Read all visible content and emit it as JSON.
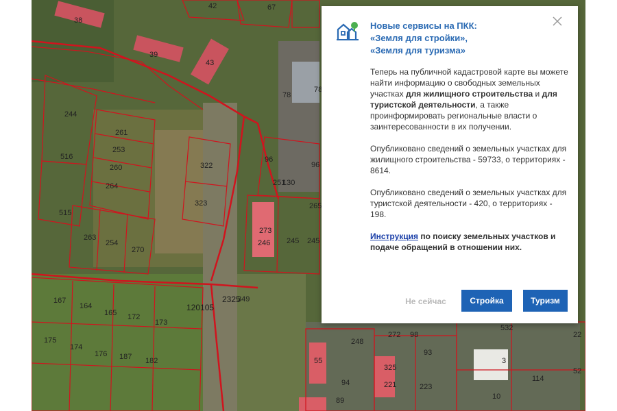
{
  "map": {
    "plot_labels": [
      "38",
      "39",
      "42",
      "43",
      "67",
      "78",
      "78",
      "96",
      "96",
      "130",
      "244",
      "253",
      "254",
      "260",
      "261",
      "263",
      "264",
      "270",
      "273",
      "245",
      "246",
      "251",
      "322",
      "323",
      "515",
      "516",
      "167",
      "164",
      "165",
      "172",
      "173",
      "174",
      "175",
      "176",
      "182",
      "187",
      "248",
      "272",
      "98",
      "93",
      "55",
      "94",
      "89",
      "221",
      "223",
      "325",
      "532",
      "22",
      "3",
      "114",
      "52",
      "10",
      "349",
      "265",
      "245"
    ],
    "road_label": "120105",
    "road_label_2": "2325"
  },
  "popup": {
    "title_lines": [
      "Новые сервисы на ПКК:",
      "«Земля для стройки»,",
      "«Земля для туризма»"
    ],
    "p1_text1": "Теперь на публичной кадастровой карте вы можете найти информацию о свободных земельных участках ",
    "p1_bold1": "для жилищного строительства",
    "p1_text2": " и ",
    "p1_bold2": "для туристской деятельности",
    "p1_text3": ", а также проинформировать региональные власти о заинтересованности в их получении.",
    "p2": "Опубликовано сведений о земельных участках для жилищного строительства - 59733, о территориях - 8614.",
    "p3": "Опубликовано сведений о земельных участках для туристской деятельности - 420, о территориях - 198.",
    "p4_link": "Инструкция",
    "p4_rest": " по поиску земельных участков и подаче обращений в отношении них.",
    "btn_later": "Не сейчас",
    "btn_build": "Стройка",
    "btn_tour": "Туризм"
  },
  "colors": {
    "accent": "#1e63b5",
    "title": "#2a6ab3",
    "parcel": "#d0141e"
  }
}
